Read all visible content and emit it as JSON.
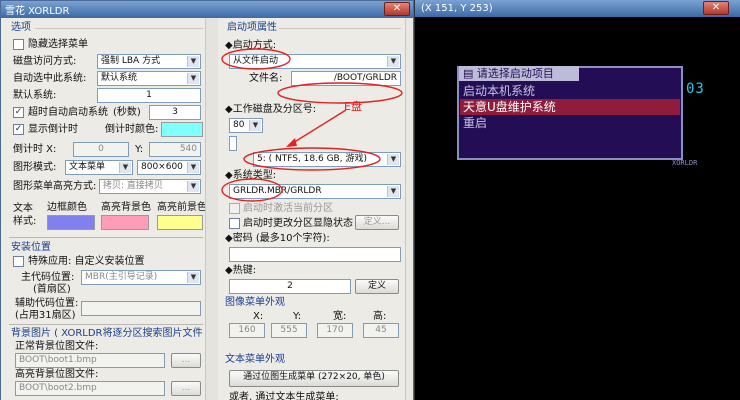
{
  "window": {
    "title": "雪花 XORLDR",
    "close_glyph": "✕"
  },
  "left": {
    "section_options": "选项",
    "hide_menu": "隐藏选择菜单",
    "disk_access_label": "磁盘访问方式:",
    "disk_access_value": "强制 LBA 方式",
    "auto_select_label": "自动选中此系统:",
    "auto_select_value": "默认系统",
    "default_system_label": "默认系统:",
    "default_system_value": "1",
    "timeout_label": "超时自动启动系统",
    "timeout_unit": "(秒数)",
    "timeout_value": "3",
    "show_countdown": "显示倒计时",
    "countdown_color_label": "倒计时颜色:",
    "countdown_x_label": "倒计时 X:",
    "countdown_x_value": "0",
    "countdown_y_label": "Y:",
    "countdown_y_value": "540",
    "graphic_mode_label": "图形模式:",
    "graphic_mode_value": "文本菜单",
    "resolution_value": "800×600",
    "highlight_mode_label": "图形菜单高亮方式:",
    "highlight_mode_value": "拷贝: 直接拷贝",
    "text_style_label": "文本样式:",
    "border_color_label": "边框颜色",
    "hl_bg_label": "高亮背景色",
    "hl_fg_label": "高亮前景色",
    "section_install": "安装位置",
    "special_app": "特殊应用: 自定义安装位置",
    "main_code_label": "主代码位置:",
    "main_code_sub": "(首扇区)",
    "main_code_value": "MBR(主引导记录)",
    "aux_code_label": "辅助代码位置:",
    "aux_code_sub": "(占用31扇区)",
    "aux_code_value": "",
    "section_bg": "背景图片 ( XORLDR将逐分区搜索图片文件 )",
    "normal_bg_label": "正常背景位图文件:",
    "normal_bg_value": "BOOT\\boot1.bmp",
    "hl_bg_file_label": "高亮背景位图文件:",
    "hl_bg_file_value": "BOOT\\boot2.bmp",
    "browse_label": "..."
  },
  "right": {
    "boot_props": "启动项属性",
    "boot_method_label": "启动方式:",
    "boot_method_value": "从文件启动",
    "file_name_label": "文件名:",
    "file_name_value": "/BOOT/GRLDR",
    "work_disk_label": "工作磁盘及分区号:",
    "disk_number": "80",
    "partition_value": "5: ( NTFS,  18.6 GB, 游戏)",
    "system_type_label": "系统类型:",
    "system_type_value": "GRLDR.MBR/GRLDR",
    "activate_partition": "启动时激活当前分区",
    "change_partition_hide": "启动时更改分区显隐状态",
    "define_label": "定义...",
    "password_label": "密码 (最多10个字符):",
    "password_value": "",
    "hotkey_label": "热键:",
    "hotkey_value": "2",
    "define_label2": "定义",
    "image_menu_appearance": "图像菜单外观",
    "col_x": "X:",
    "col_y": "Y:",
    "col_w": "宽:",
    "col_h": "高:",
    "img_x": "160",
    "img_y": "555",
    "img_w": "170",
    "img_h": "45",
    "text_menu_appearance": "文本菜单外观",
    "gen_text_menu_btn": "通过位图生成菜单 (272×20, 单色)",
    "or_text": "或者, 通过文本生成菜单:"
  },
  "annotation": {
    "label": "E盘"
  },
  "console": {
    "title": "(X 151, Y 253)",
    "menu_header": "请选择启动项目",
    "items": [
      "启动本机系统",
      "天意U盘维护系统",
      "重启"
    ],
    "countdown": "03",
    "brand": "XORLDR"
  },
  "colors": {
    "countdown_swatch": "#80ffff",
    "border_swatch": "#8080ee",
    "hl_bg_swatch": "#ff9cb8",
    "hl_fg_swatch": "#ffff90",
    "annotation": "#e42020",
    "console_bg": "#000000",
    "menu_bg": "#230e55",
    "menu_highlight": "#8f1c3a"
  }
}
